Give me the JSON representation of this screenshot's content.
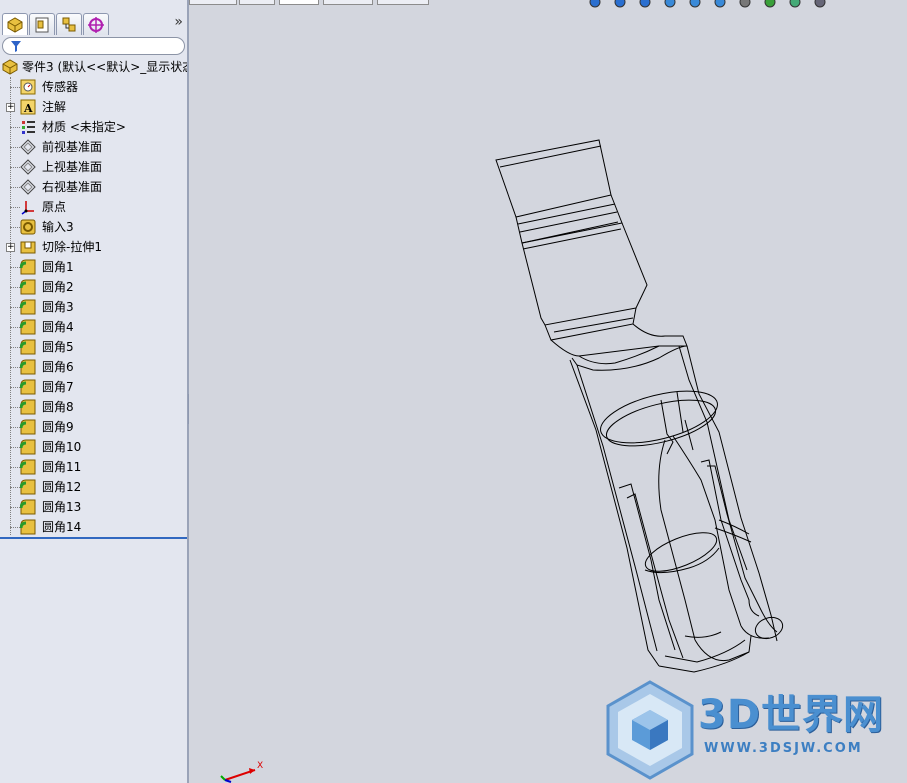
{
  "feature_manager": {
    "tabs": [
      {
        "name": "feature-manager-tab",
        "icon": "feature-tree-icon"
      },
      {
        "name": "property-manager-tab",
        "icon": "property-icon"
      },
      {
        "name": "configuration-manager-tab",
        "icon": "configuration-icon"
      },
      {
        "name": "dimxpert-tab",
        "icon": "target-icon"
      }
    ],
    "more_tabs": "»",
    "filter_icon": "filter-icon",
    "tree": [
      {
        "label": "零件3  (默认<<默认>_显示状态",
        "icon": "part-icon",
        "indent": 0
      },
      {
        "label": "传感器",
        "icon": "sensor-icon",
        "indent": 1
      },
      {
        "label": "注解",
        "icon": "annotation-icon",
        "indent": 1,
        "expandable": true
      },
      {
        "label": "材质 <未指定>",
        "icon": "material-icon",
        "indent": 1
      },
      {
        "label": "前视基准面",
        "icon": "plane-icon",
        "indent": 1
      },
      {
        "label": "上视基准面",
        "icon": "plane-icon",
        "indent": 1
      },
      {
        "label": "右视基准面",
        "icon": "plane-icon",
        "indent": 1
      },
      {
        "label": "原点",
        "icon": "origin-icon",
        "indent": 1
      },
      {
        "label": "输入3",
        "icon": "imported-body-icon",
        "indent": 1
      },
      {
        "label": "切除-拉伸1",
        "icon": "cut-extrude-icon",
        "indent": 1,
        "expandable": true
      },
      {
        "label": "圆角1",
        "icon": "fillet-icon",
        "indent": 1
      },
      {
        "label": "圆角2",
        "icon": "fillet-icon",
        "indent": 1
      },
      {
        "label": "圆角3",
        "icon": "fillet-icon",
        "indent": 1
      },
      {
        "label": "圆角4",
        "icon": "fillet-icon",
        "indent": 1
      },
      {
        "label": "圆角5",
        "icon": "fillet-icon",
        "indent": 1
      },
      {
        "label": "圆角6",
        "icon": "fillet-icon",
        "indent": 1
      },
      {
        "label": "圆角7",
        "icon": "fillet-icon",
        "indent": 1
      },
      {
        "label": "圆角8",
        "icon": "fillet-icon",
        "indent": 1
      },
      {
        "label": "圆角9",
        "icon": "fillet-icon",
        "indent": 1
      },
      {
        "label": "圆角10",
        "icon": "fillet-icon",
        "indent": 1
      },
      {
        "label": "圆角11",
        "icon": "fillet-icon",
        "indent": 1
      },
      {
        "label": "圆角12",
        "icon": "fillet-icon",
        "indent": 1
      },
      {
        "label": "圆角13",
        "icon": "fillet-icon",
        "indent": 1
      },
      {
        "label": "圆角14",
        "icon": "fillet-icon",
        "indent": 1
      }
    ]
  },
  "view_toolbar": {
    "icons": [
      "zoom-to-fit-icon",
      "zoom-area-icon",
      "previous-view-icon",
      "section-view-icon",
      "view-orientation-icon",
      "display-style-icon",
      "hide-show-icon",
      "appearance-icon",
      "scene-icon",
      "view-settings-icon"
    ]
  },
  "viewport": {
    "background": "#d3d6de",
    "triad_axis_label": "X"
  },
  "watermark": {
    "title": "3D世界网",
    "url": "WWW.3DSJW.COM",
    "color": "#4a8fd0"
  }
}
